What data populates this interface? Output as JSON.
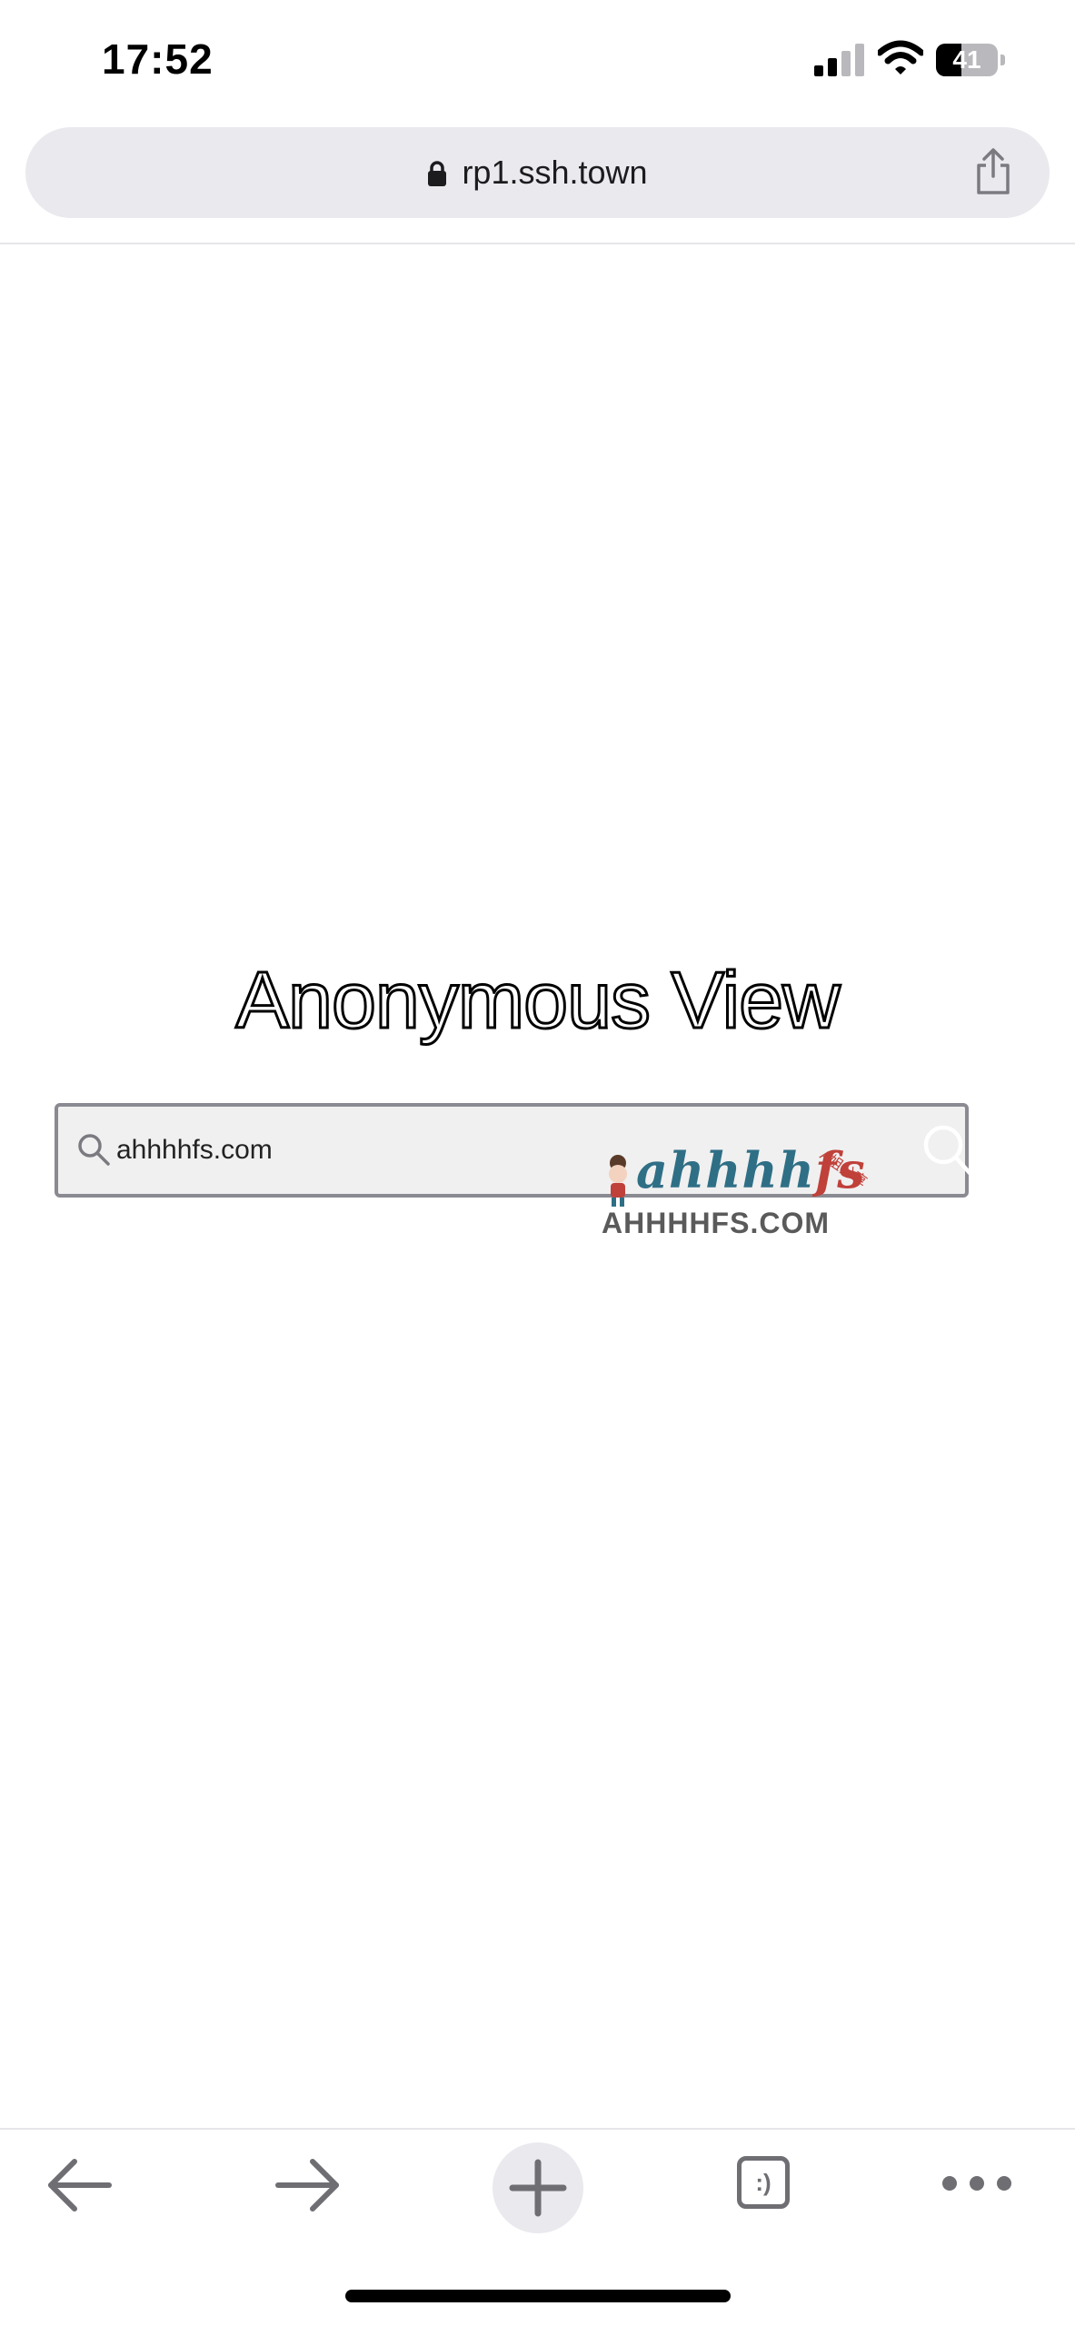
{
  "status_bar": {
    "time": "17:52",
    "battery_level": "41",
    "battery_fraction": 0.41,
    "icons": [
      "cellular-signal-icon",
      "wifi-icon",
      "battery-icon"
    ]
  },
  "address_bar": {
    "url": "rp1.ssh.town",
    "icons": [
      "lock-icon",
      "share-icon"
    ]
  },
  "page": {
    "title": "Anonymous View",
    "search": {
      "value": "ahhhhfs.com",
      "icons": [
        "search-icon",
        "search-submit-icon"
      ]
    }
  },
  "watermark": {
    "script_main": "ahhhh",
    "script_accent": "fs",
    "tag": "A姐分享",
    "domain": "AHHHHFS.COM"
  },
  "toolbar": {
    "tabs_label": ":)",
    "icons": [
      "back-arrow-icon",
      "forward-arrow-icon",
      "plus-icon",
      "tabs-icon",
      "more-icon"
    ]
  },
  "colors": {
    "background": "#ffffff",
    "address_bar_bg": "#e9e9ee",
    "toolbar_icon": "#6e6e73",
    "search_border": "#8a8a92",
    "search_bg": "#f0f0f0"
  }
}
